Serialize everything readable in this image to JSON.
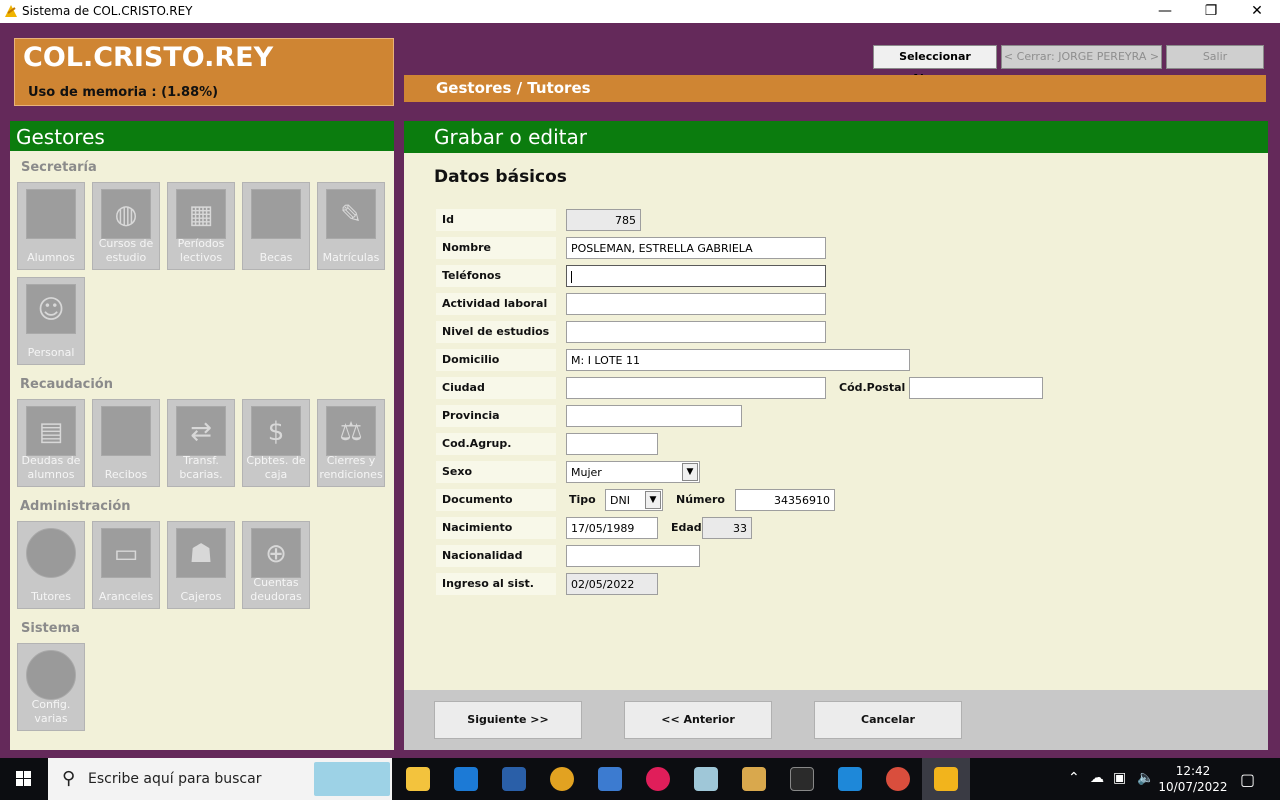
{
  "window": {
    "title": "Sistema de COL.CRISTO.REY",
    "minimize": "—",
    "restore": "❐",
    "close": "✕"
  },
  "brand": {
    "name": "COL.CRISTO.REY",
    "memory": "Uso de memoria : (1.88%)"
  },
  "topbar": {
    "select_student": "Seleccionar Alumno",
    "close_session": "< Cerrar: JORGE PEREYRA >",
    "exit": "Salir"
  },
  "section_title": "Gestores / Tutores",
  "sidebar": {
    "title": "Gestores",
    "groups": [
      {
        "label": "Secretaría",
        "items": [
          {
            "label": "Alumnos",
            "icon": "students-icon"
          },
          {
            "label": "Cursos de estudio",
            "icon": "courses-icon"
          },
          {
            "label": "Períodos lectivos",
            "icon": "calendar-icon"
          },
          {
            "label": "Becas",
            "icon": "scholarship-icon"
          },
          {
            "label": "Matrículas",
            "icon": "enrollment-icon"
          },
          {
            "label": "Personal",
            "icon": "staff-icon"
          }
        ]
      },
      {
        "label": "Recaudación",
        "items": [
          {
            "label": "Deudas de alumnos",
            "icon": "debts-icon"
          },
          {
            "label": "Recibos",
            "icon": "receipt-icon"
          },
          {
            "label": "Transf. bcarias.",
            "icon": "transfer-icon"
          },
          {
            "label": "Cpbtes. de caja",
            "icon": "cash-voucher-icon"
          },
          {
            "label": "Cierres y rendiciones",
            "icon": "closing-icon"
          }
        ]
      },
      {
        "label": "Administración",
        "items": [
          {
            "label": "Tutores",
            "icon": "tutors-icon"
          },
          {
            "label": "Aranceles",
            "icon": "fees-icon"
          },
          {
            "label": "Cajeros",
            "icon": "cashier-icon"
          },
          {
            "label": "Cuentas deudoras",
            "icon": "debtor-accounts-icon"
          }
        ]
      },
      {
        "label": "Sistema",
        "items": [
          {
            "label": "Config. varias",
            "icon": "settings-icon"
          }
        ]
      }
    ]
  },
  "form": {
    "header": "Grabar o editar",
    "subtitle": "Datos básicos",
    "labels": {
      "id": "Id",
      "nombre": "Nombre",
      "telefonos": "Teléfonos",
      "actividad": "Actividad laboral",
      "nivel": "Nivel de estudios",
      "domicilio": "Domicilio",
      "ciudad": "Ciudad",
      "cp": "Cód.Postal",
      "provincia": "Provincia",
      "codagrup": "Cod.Agrup.",
      "sexo": "Sexo",
      "documento": "Documento",
      "tipo": "Tipo",
      "numero": "Número",
      "nacimiento": "Nacimiento",
      "edad": "Edad",
      "nacionalidad": "Nacionalidad",
      "ingreso": "Ingreso al sist."
    },
    "values": {
      "id": "785",
      "nombre": "POSLEMAN, ESTRELLA GABRIELA",
      "telefonos": "",
      "actividad": "",
      "nivel": "",
      "domicilio": "M: I LOTE 11",
      "ciudad": "",
      "cp": "",
      "provincia": "",
      "codagrup": "",
      "sexo": "Mujer",
      "tipo": "DNI",
      "numero": "34356910",
      "nacimiento": "17/05/1989",
      "edad": "33",
      "nacionalidad": "",
      "ingreso": "02/05/2022"
    }
  },
  "buttons": {
    "next": "Siguiente >>",
    "prev": "<< Anterior",
    "cancel": "Cancelar"
  },
  "taskbar": {
    "search_placeholder": "Escribe aquí para buscar",
    "time": "12:42",
    "date": "10/07/2022"
  }
}
